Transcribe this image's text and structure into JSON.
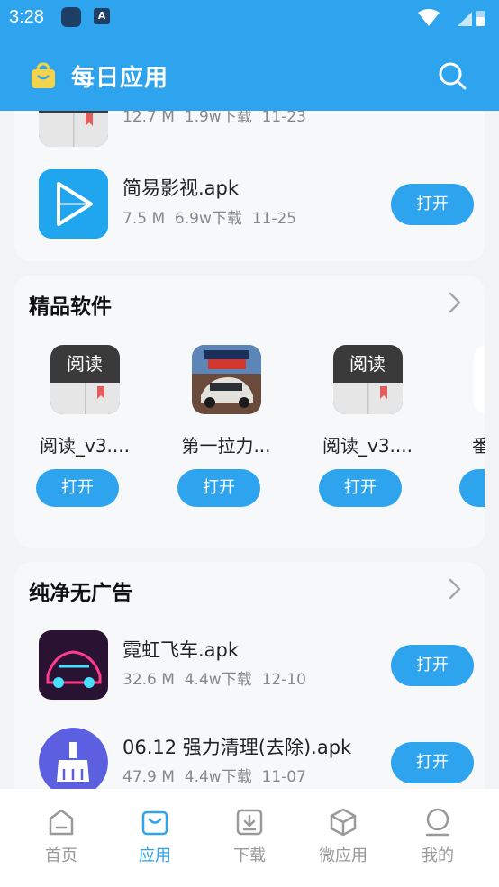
{
  "status_bar": {
    "time": "3:28",
    "notif_badge": "A"
  },
  "header": {
    "title": "每日应用"
  },
  "recent_list": [
    {
      "name": "",
      "size": "12.7 M",
      "downloads": "1.9w下载",
      "date": "11-23",
      "icon": "reader-icon"
    },
    {
      "name": "简易影视.apk",
      "size": "7.5 M",
      "downloads": "6.9w下载",
      "date": "11-25",
      "icon": "play-icon",
      "button": "打开"
    }
  ],
  "featured": {
    "title": "精品软件",
    "items": [
      {
        "name": "阅读_v3....",
        "button": "打开",
        "icon": "reader-icon"
      },
      {
        "name": "第一拉力...",
        "button": "打开",
        "icon": "rally-game-icon"
      },
      {
        "name": "阅读_v3....",
        "button": "打开",
        "icon": "reader-icon"
      },
      {
        "name": "番茄",
        "button": "打开",
        "icon": "green-app-icon"
      }
    ]
  },
  "adfree": {
    "title": "纯净无广告",
    "items": [
      {
        "name": "霓虹飞车.apk",
        "size": "32.6 M",
        "downloads": "4.4w下载",
        "date": "12-10",
        "button": "打开",
        "icon": "neon-car-icon"
      },
      {
        "name": "06.12 强力清理(去除).apk",
        "size": "47.9 M",
        "downloads": "4.4w下载",
        "date": "11-07",
        "button": "打开",
        "icon": "broom-icon"
      }
    ]
  },
  "bottom_nav": [
    {
      "label": "首页",
      "icon": "home-icon",
      "active": false
    },
    {
      "label": "应用",
      "icon": "shopping-bag-icon",
      "active": true
    },
    {
      "label": "下载",
      "icon": "download-icon",
      "active": false
    },
    {
      "label": "微应用",
      "icon": "cube-icon",
      "active": false
    },
    {
      "label": "我的",
      "icon": "profile-icon",
      "active": false
    }
  ],
  "colors": {
    "accent": "#2ea3ee",
    "card": "#f7f8fa",
    "background": "#f2f3f5"
  }
}
